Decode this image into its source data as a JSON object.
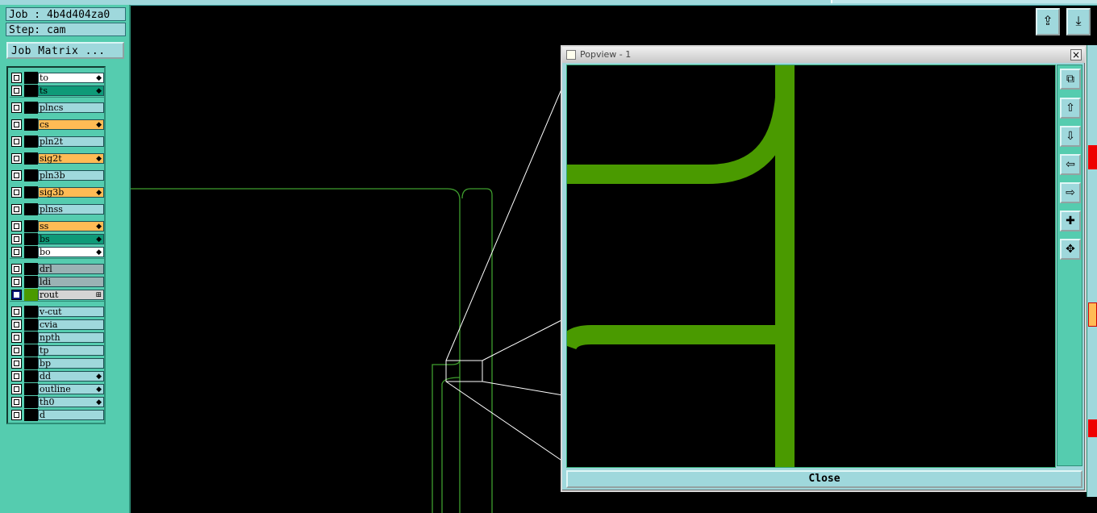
{
  "header": {
    "job": "Job : 4b4d404za0",
    "step": "Step: cam",
    "job_matrix": "Job Matrix ..."
  },
  "layers": [
    {
      "name": "to",
      "color": "#ffffff",
      "pin": true
    },
    {
      "name": "ts",
      "color": "#0f9a78",
      "pin": true
    },
    {
      "name": "plncs",
      "color": "#9fd8dc",
      "pin": false
    },
    {
      "name": "cs",
      "color": "#ffbb55",
      "pin": true
    },
    {
      "name": "pln2t",
      "color": "#9fd8dc",
      "pin": false
    },
    {
      "name": "sig2t",
      "color": "#ffbb55",
      "pin": true
    },
    {
      "name": "pln3b",
      "color": "#9fd8dc",
      "pin": false
    },
    {
      "name": "sig3b",
      "color": "#ffbb55",
      "pin": true
    },
    {
      "name": "plnss",
      "color": "#9fd8dc",
      "pin": false
    },
    {
      "name": "ss",
      "color": "#ffbb55",
      "pin": true
    },
    {
      "name": "bs",
      "color": "#0f9a78",
      "pin": true
    },
    {
      "name": "bo",
      "color": "#ffffff",
      "pin": true
    },
    {
      "name": "drl",
      "color": "#9ab2b4",
      "pin": false
    },
    {
      "name": "ldi",
      "color": "#9ab2b4",
      "pin": false
    },
    {
      "name": "rout",
      "color": "#d4d4d4",
      "pin": false,
      "selected": true
    },
    {
      "name": "v-cut",
      "color": "#9fd8dc",
      "pin": false
    },
    {
      "name": "cvia",
      "color": "#9fd8dc",
      "pin": false
    },
    {
      "name": "npth",
      "color": "#9fd8dc",
      "pin": false
    },
    {
      "name": "tp",
      "color": "#9fd8dc",
      "pin": false
    },
    {
      "name": "bp",
      "color": "#9fd8dc",
      "pin": false
    },
    {
      "name": "dd",
      "color": "#9fd8dc",
      "pin": true
    },
    {
      "name": "outline",
      "color": "#9fd8dc",
      "pin": true
    },
    {
      "name": "th0",
      "color": "#9fd8dc",
      "pin": true
    },
    {
      "name": "d",
      "color": "#9fd8dc",
      "pin": false
    }
  ],
  "popview": {
    "title": "Popview - 1",
    "close_label": "Close",
    "close_x": "×"
  },
  "colors": {
    "panel": "#55ccaf",
    "field": "#9fd8dc",
    "trace": "#4a9a00",
    "outline": "#3f9e2e"
  }
}
